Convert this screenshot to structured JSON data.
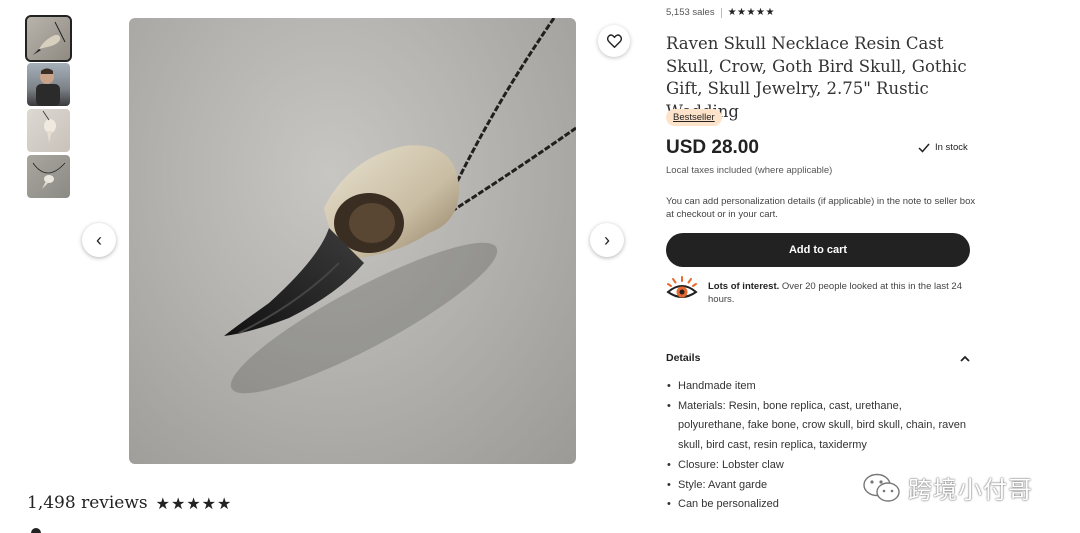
{
  "gallery": {
    "thumbnails": [
      "skull-necklace-view",
      "model-wearing-necklace",
      "skull-top-view",
      "skull-on-chain-view"
    ],
    "prev_icon": "‹",
    "next_icon": "›",
    "favorite_icon": "heart-icon"
  },
  "reviews": {
    "count_label": "1,498 reviews",
    "stars": "★★★★★"
  },
  "listing": {
    "sales": "5,153 sales",
    "stars": "★★★★★",
    "title": "Raven Skull Necklace Resin Cast Skull, Crow, Goth Bird Skull, Gothic Gift, Skull Jewelry, 2.75\" Rustic Wedding",
    "badge": "Bestseller",
    "price": "USD 28.00",
    "stock": "In stock",
    "tax_note": "Local taxes included (where applicable)",
    "personalization_note": "You can add personalization details (if applicable) in the note to seller box at checkout or in your cart.",
    "add_to_cart": "Add to cart",
    "interest_bold": "Lots of interest.",
    "interest_text": " Over 20 people looked at this in the last 24 hours."
  },
  "details": {
    "heading": "Details",
    "items": [
      "Handmade item",
      "Materials: Resin, bone replica, cast, urethane, polyurethane, fake bone, crow skull, bird skull, chain, raven skull, bird cast, resin replica, taxidermy",
      "Closure: Lobster claw",
      "Style: Avant garde",
      "Can be personalized"
    ]
  },
  "watermark": {
    "text": "跨境小付哥"
  },
  "colors": {
    "primary_button": "#222222",
    "badge_bg": "#fde3c9"
  }
}
